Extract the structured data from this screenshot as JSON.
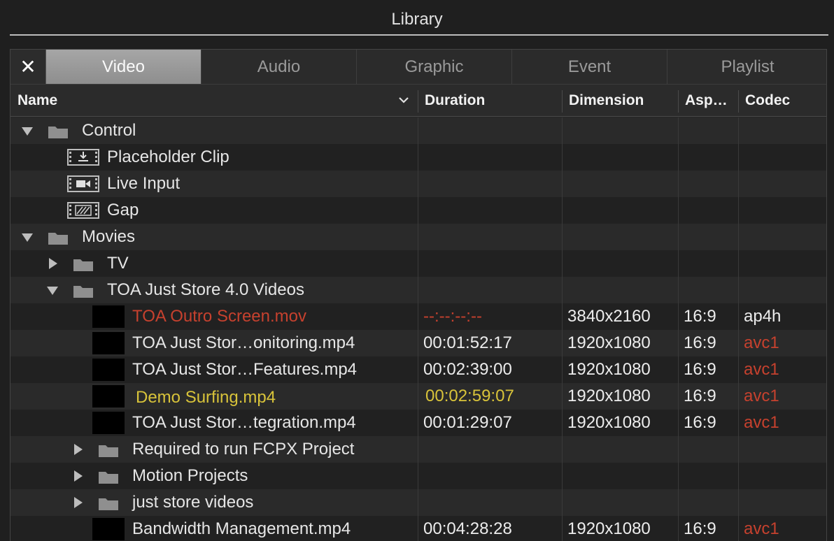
{
  "window": {
    "title": "Library"
  },
  "tabs": [
    {
      "label": "Video",
      "active": true
    },
    {
      "label": "Audio",
      "active": false
    },
    {
      "label": "Graphic",
      "active": false
    },
    {
      "label": "Event",
      "active": false
    },
    {
      "label": "Playlist",
      "active": false
    }
  ],
  "close_glyph": "✕",
  "columns": {
    "name": "Name",
    "duration": "Duration",
    "dimension": "Dimension",
    "aspect": "Asp…",
    "codec": "Codec"
  },
  "colors": {
    "accent_red": "#c6412e",
    "accent_yellow": "#d8c33a",
    "active_tab": "#9a9a9a"
  },
  "rows": [
    {
      "name": "Control",
      "kind": "folder",
      "expanded": true
    },
    {
      "name": "Placeholder Clip",
      "kind": "placeholder-clip-icon"
    },
    {
      "name": "Live Input",
      "kind": "live-input-icon"
    },
    {
      "name": "Gap",
      "kind": "gap-icon"
    },
    {
      "name": "Movies",
      "kind": "folder",
      "expanded": true
    },
    {
      "name": "TV",
      "kind": "folder",
      "expanded": false
    },
    {
      "name": "TOA Just Store 4.0 Videos",
      "kind": "folder",
      "expanded": true
    },
    {
      "name": "TOA Outro Screen.mov",
      "kind": "media",
      "duration": "--:--:--:--",
      "dimension": "3840x2160",
      "aspect": "16:9",
      "codec": "ap4h",
      "status": "missing"
    },
    {
      "name": "TOA Just Stor…onitoring.mp4",
      "kind": "media",
      "duration": "00:01:52:17",
      "dimension": "1920x1080",
      "aspect": "16:9",
      "codec": "avc1"
    },
    {
      "name": "TOA Just Stor…Features.mp4",
      "kind": "media",
      "duration": "00:02:39:00",
      "dimension": "1920x1080",
      "aspect": "16:9",
      "codec": "avc1"
    },
    {
      "name": "Demo Surfing.mp4",
      "kind": "media",
      "duration": "00:02:59:07",
      "dimension": "1920x1080",
      "aspect": "16:9",
      "codec": "avc1",
      "status": "highlighted"
    },
    {
      "name": "TOA Just Stor…tegration.mp4",
      "kind": "media",
      "duration": "00:01:29:07",
      "dimension": "1920x1080",
      "aspect": "16:9",
      "codec": "avc1"
    },
    {
      "name": "Required to run FCPX Project",
      "kind": "folder",
      "expanded": false
    },
    {
      "name": "Motion Projects",
      "kind": "folder",
      "expanded": false
    },
    {
      "name": "just store videos",
      "kind": "folder",
      "expanded": false
    },
    {
      "name": "Bandwidth Management.mp4",
      "kind": "media",
      "duration": "00:04:28:28",
      "dimension": "1920x1080",
      "aspect": "16:9",
      "codec": "avc1"
    }
  ]
}
